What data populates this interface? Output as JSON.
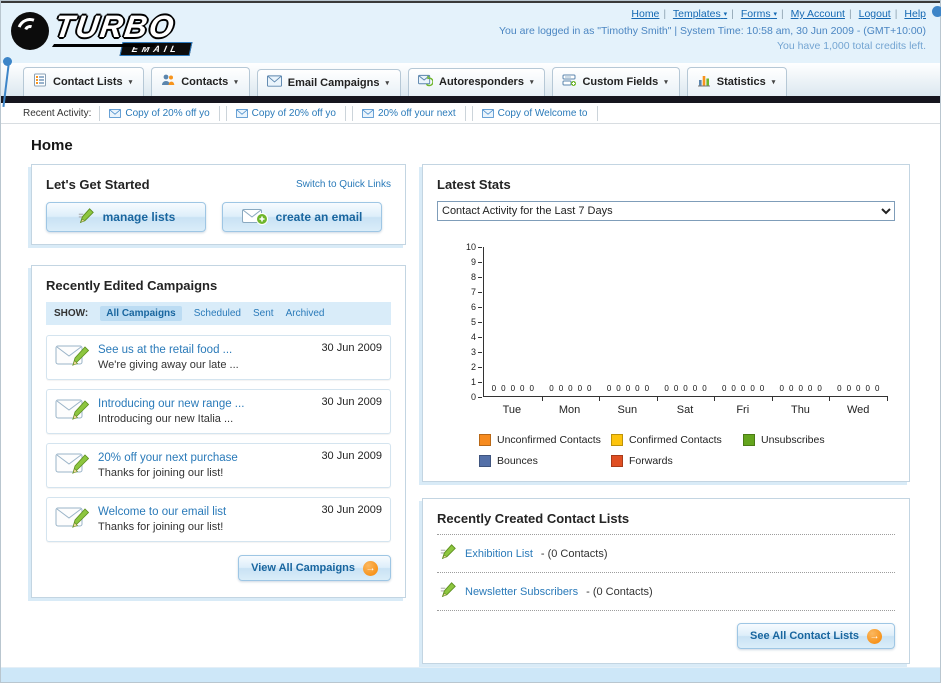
{
  "icons": {
    "caret": "▾",
    "arrow": "→",
    "pipe": "|"
  },
  "header": {
    "logo_main": "TURBO",
    "logo_sub": "EMAIL",
    "links": [
      {
        "label": "Home"
      },
      {
        "label": "Templates"
      },
      {
        "label": "Forms"
      },
      {
        "label": "My Account"
      },
      {
        "label": "Logout"
      },
      {
        "label": "Help"
      }
    ],
    "login_info": "You are logged in as \"Timothy Smith\" | System Time: 10:58 am, 30 Jun 2009 - (GMT+10:00)",
    "credits_info": "You have 1,000 total credits left."
  },
  "nav": {
    "tabs": [
      {
        "label": "Contact Lists"
      },
      {
        "label": "Contacts"
      },
      {
        "label": "Email Campaigns"
      },
      {
        "label": "Autoresponders"
      },
      {
        "label": "Custom Fields"
      },
      {
        "label": "Statistics"
      }
    ]
  },
  "recent_activity": {
    "label": "Recent Activity:",
    "items": [
      "Copy of 20% off yo",
      "Copy of 20% off yo",
      "20% off your next",
      "Copy of Welcome to"
    ]
  },
  "page": {
    "title": "Home"
  },
  "get_started": {
    "title": "Let's Get Started",
    "switch_link": "Switch to Quick Links",
    "manage_lists_label": "manage lists",
    "create_email_label": "create an email"
  },
  "campaigns": {
    "title": "Recently Edited Campaigns",
    "show_label": "SHOW:",
    "tabs": [
      "All Campaigns",
      "Scheduled",
      "Sent",
      "Archived"
    ],
    "selected_tab": "All Campaigns",
    "items": [
      {
        "title": "See us at the retail food ...",
        "subtitle": "We're giving away our late ...",
        "date": "30 Jun 2009"
      },
      {
        "title": "Introducing our new range ...",
        "subtitle": "Introducing our new Italia ...",
        "date": "30 Jun 2009"
      },
      {
        "title": "20% off your next purchase",
        "subtitle": "Thanks for joining our list!",
        "date": "30 Jun 2009"
      },
      {
        "title": "Welcome to our email list",
        "subtitle": "Thanks for joining our list!",
        "date": "30 Jun 2009"
      }
    ],
    "view_all_label": "View All Campaigns"
  },
  "stats": {
    "title": "Latest Stats",
    "dropdown_value": "Contact Activity for the Last 7 Days"
  },
  "chart_data": {
    "type": "bar",
    "title": "Contact Activity for the Last 7 Days",
    "categories": [
      "Tue",
      "Mon",
      "Sun",
      "Sat",
      "Fri",
      "Thu",
      "Wed"
    ],
    "series": [
      {
        "name": "Unconfirmed Contacts",
        "color": "#f68b1f",
        "values": [
          0,
          0,
          0,
          0,
          0,
          0,
          0
        ]
      },
      {
        "name": "Confirmed Contacts",
        "color": "#fdc40d",
        "values": [
          0,
          0,
          0,
          0,
          0,
          0,
          0
        ]
      },
      {
        "name": "Unsubscribes",
        "color": "#64a51d",
        "values": [
          0,
          0,
          0,
          0,
          0,
          0,
          0
        ]
      },
      {
        "name": "Bounces",
        "color": "#5470a8",
        "values": [
          0,
          0,
          0,
          0,
          0,
          0,
          0
        ]
      },
      {
        "name": "Forwards",
        "color": "#e04f23",
        "values": [
          0,
          0,
          0,
          0,
          0,
          0,
          0
        ]
      }
    ],
    "ylim": [
      0,
      10
    ],
    "ytick_step": 1,
    "grid": false,
    "legend_position": "bottom"
  },
  "contact_lists": {
    "title": "Recently Created Contact Lists",
    "items": [
      {
        "name": "Exhibition List",
        "detail": "- (0 Contacts)"
      },
      {
        "name": "Newsletter Subscribers",
        "detail": "- (0 Contacts)"
      }
    ],
    "see_all_label": "See All Contact Lists"
  }
}
